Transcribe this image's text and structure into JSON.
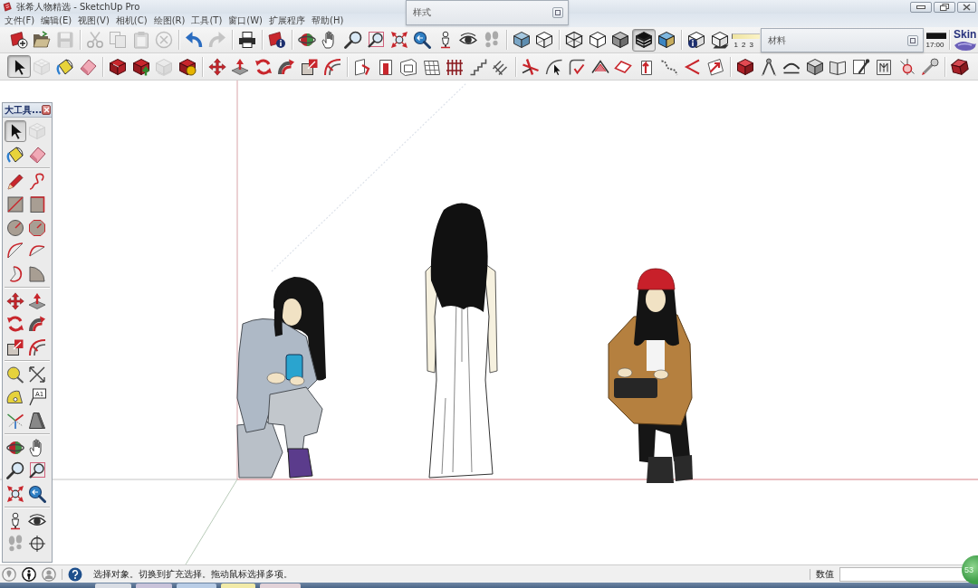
{
  "window": {
    "title": "张希人物精选 - SketchUp Pro"
  },
  "menu": [
    "文件(F)",
    "编辑(E)",
    "视图(V)",
    "相机(C)",
    "绘图(R)",
    "工具(T)",
    "窗口(W)",
    "扩展程序",
    "帮助(H)"
  ],
  "floating_panels": [
    {
      "title": "样式"
    },
    {
      "title": "材料"
    }
  ],
  "toolbar_rows": [
    {
      "buttons": [
        {
          "selected": false,
          "disabled": false
        },
        {
          "selected": false,
          "disabled": false
        },
        {
          "selected": false,
          "disabled": true
        },
        {
          "selected": false,
          "disabled": true
        },
        {
          "selected": false,
          "disabled": true
        },
        {
          "selected": false,
          "disabled": true
        },
        {
          "selected": false,
          "disabled": true
        },
        {
          "selected": false,
          "disabled": false
        },
        {
          "selected": false,
          "disabled": true
        },
        {
          "selected": false,
          "disabled": false
        },
        {
          "selected": false,
          "disabled": false
        },
        {
          "selected": false,
          "disabled": false
        },
        {
          "selected": false,
          "disabled": false
        },
        {
          "selected": false,
          "disabled": false
        },
        {
          "selected": false,
          "disabled": false
        },
        {
          "selected": false,
          "disabled": false
        },
        {
          "selected": false,
          "disabled": false
        },
        {
          "selected": false,
          "disabled": false
        },
        {
          "selected": false,
          "disabled": false
        },
        {
          "selected": false,
          "disabled": false
        },
        {
          "selected": false,
          "disabled": false
        },
        {
          "selected": false,
          "disabled": false
        },
        {
          "selected": false,
          "disabled": false
        },
        {
          "selected": false,
          "disabled": false
        },
        {
          "selected": false,
          "disabled": false
        },
        {
          "selected": true,
          "disabled": false
        },
        {
          "selected": false,
          "disabled": false
        },
        {
          "selected": false,
          "disabled": false
        },
        {
          "selected": false,
          "disabled": false
        }
      ]
    },
    {
      "buttons": [
        {
          "selected": true,
          "disabled": false
        },
        {
          "selected": false,
          "disabled": true
        },
        {
          "selected": false,
          "disabled": false
        },
        {
          "selected": false,
          "disabled": false
        },
        {
          "selected": false,
          "disabled": false
        },
        {
          "selected": false,
          "disabled": false
        },
        {
          "selected": false,
          "disabled": true
        },
        {
          "selected": false,
          "disabled": false
        },
        {
          "selected": false,
          "disabled": false
        },
        {
          "selected": false,
          "disabled": false
        },
        {
          "selected": false,
          "disabled": false
        },
        {
          "selected": false,
          "disabled": false
        },
        {
          "selected": false,
          "disabled": false
        },
        {
          "selected": false,
          "disabled": false
        },
        {
          "selected": false,
          "disabled": false
        },
        {
          "selected": false,
          "disabled": false
        },
        {
          "selected": false,
          "disabled": false
        },
        {
          "selected": false,
          "disabled": false
        },
        {
          "selected": false,
          "disabled": false
        },
        {
          "selected": false,
          "disabled": false
        },
        {
          "selected": false,
          "disabled": false
        },
        {
          "selected": false,
          "disabled": false
        },
        {
          "selected": false,
          "disabled": false
        },
        {
          "selected": false,
          "disabled": false
        },
        {
          "selected": false,
          "disabled": false
        },
        {
          "selected": false,
          "disabled": false
        },
        {
          "selected": false,
          "disabled": false
        },
        {
          "selected": false,
          "disabled": false
        },
        {
          "selected": false,
          "disabled": false
        },
        {
          "selected": false,
          "disabled": false
        },
        {
          "selected": false,
          "disabled": false
        },
        {
          "selected": false,
          "disabled": false
        },
        {
          "selected": false,
          "disabled": false
        },
        {
          "selected": false,
          "disabled": false
        },
        {
          "selected": false,
          "disabled": false
        },
        {
          "selected": false,
          "disabled": false
        },
        {
          "selected": false,
          "disabled": false
        },
        {
          "selected": false,
          "disabled": false
        },
        {
          "selected": false,
          "disabled": false
        },
        {
          "selected": false,
          "disabled": false
        }
      ]
    }
  ],
  "shadow_settings": {
    "month_labels": [
      "1",
      "2",
      "3"
    ],
    "time": "17:00"
  },
  "skin_logo": {
    "text": "Skin"
  },
  "tool_palette": {
    "title": "大工具...",
    "label_tool_text": "A1",
    "buttons": [
      {
        "selected": true,
        "disabled": false
      },
      {
        "selected": false,
        "disabled": true
      },
      {
        "selected": false,
        "disabled": false
      },
      {
        "selected": false,
        "disabled": false
      },
      {
        "selected": false,
        "disabled": false
      },
      {
        "selected": false,
        "disabled": false
      },
      {
        "selected": false,
        "disabled": false
      },
      {
        "selected": false,
        "disabled": false
      },
      {
        "selected": false,
        "disabled": false
      },
      {
        "selected": false,
        "disabled": false
      },
      {
        "selected": false,
        "disabled": false
      },
      {
        "selected": false,
        "disabled": false
      },
      {
        "selected": false,
        "disabled": false
      },
      {
        "selected": false,
        "disabled": false
      },
      {
        "selected": false,
        "disabled": false
      },
      {
        "selected": false,
        "disabled": false
      },
      {
        "selected": false,
        "disabled": false
      },
      {
        "selected": false,
        "disabled": false
      },
      {
        "selected": false,
        "disabled": false
      },
      {
        "selected": false,
        "disabled": false
      },
      {
        "selected": false,
        "disabled": false
      },
      {
        "selected": false,
        "disabled": false
      },
      {
        "selected": false,
        "disabled": false
      },
      {
        "selected": false,
        "disabled": false
      },
      {
        "selected": false,
        "disabled": false
      },
      {
        "selected": false,
        "disabled": false
      },
      {
        "selected": false,
        "disabled": false
      },
      {
        "selected": false,
        "disabled": false
      },
      {
        "selected": false,
        "disabled": false
      },
      {
        "selected": false,
        "disabled": false
      },
      {
        "selected": false,
        "disabled": false
      },
      {
        "selected": false,
        "disabled": false
      },
      {
        "selected": false,
        "disabled": false
      },
      {
        "selected": false,
        "disabled": false
      },
      {
        "selected": false,
        "disabled": false
      },
      {
        "selected": false,
        "disabled": false
      }
    ]
  },
  "status_bar": {
    "message": "选择对象。切换到扩充选择。拖动鼠标选择多项。",
    "measurements_label": "数值"
  },
  "floating_badge": {
    "text": "53"
  }
}
